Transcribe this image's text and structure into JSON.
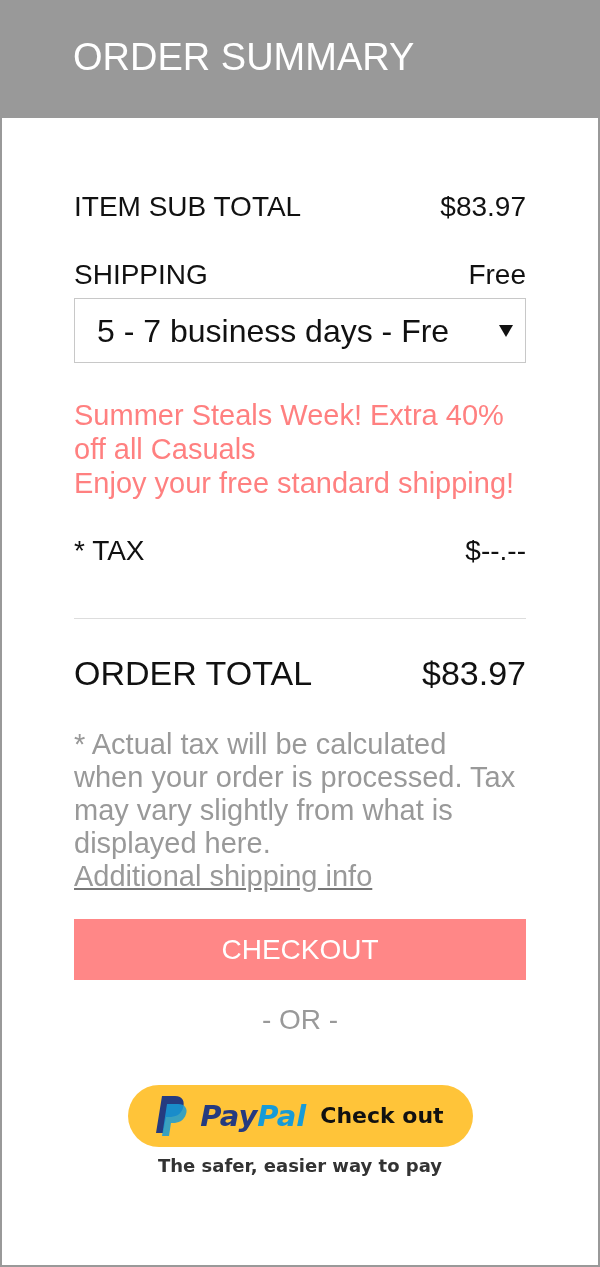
{
  "header": {
    "title": "ORDER SUMMARY"
  },
  "summary": {
    "subtotal": {
      "label": "ITEM SUB TOTAL",
      "value": "$83.97"
    },
    "shipping": {
      "label": "SHIPPING",
      "value": "Free",
      "select": {
        "value": "5 - 7 business days - Fre"
      }
    },
    "promo_messages": [
      "Summer Steals Week! Extra 40% off all Casuals",
      "Enjoy your free standard shipping!"
    ],
    "tax": {
      "label": "* TAX",
      "value": "$--.--"
    },
    "total": {
      "label": "ORDER TOTAL",
      "value": "$83.97"
    },
    "disclaimer": "* Actual tax will be calculated when your order is processed. Tax may vary slightly from what is displayed here.",
    "shipping_info_link": "Additional shipping info"
  },
  "checkout_button": "CHECKOUT",
  "separator": "- OR -",
  "paypal": {
    "brand": [
      {
        "text": "Pay",
        "color": "#253b80"
      },
      {
        "text": "Pal",
        "color": "#179bd7"
      }
    ],
    "label": "Check out",
    "tagline": "The safer, easier way to pay"
  }
}
